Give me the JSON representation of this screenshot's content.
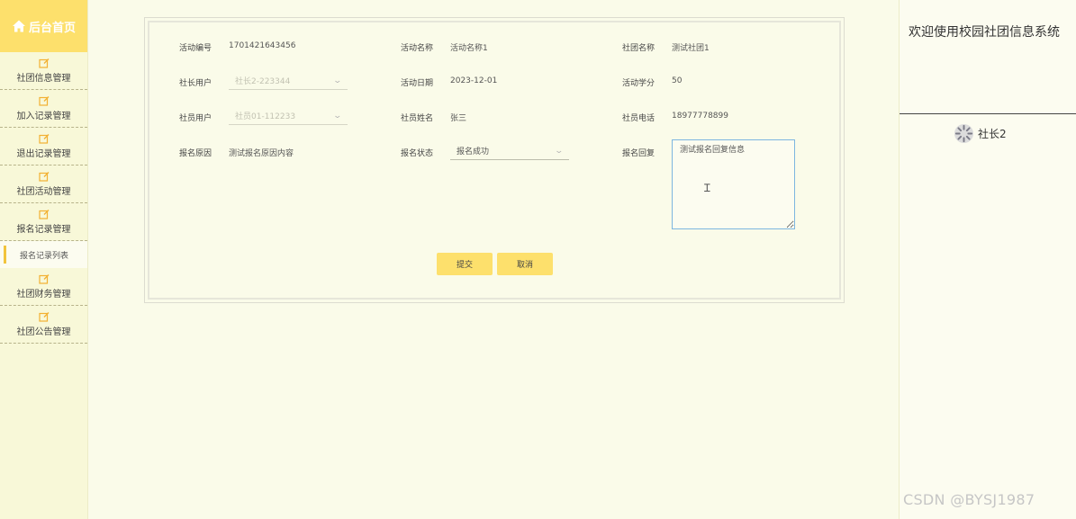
{
  "sidebar": {
    "brand": "后台首页",
    "items": [
      {
        "label": "社团信息管理"
      },
      {
        "label": "加入记录管理"
      },
      {
        "label": "退出记录管理"
      },
      {
        "label": "社团活动管理"
      },
      {
        "label": "报名记录管理"
      }
    ],
    "active_sub": "报名记录列表",
    "items_after": [
      {
        "label": "社团财务管理"
      },
      {
        "label": "社团公告管理"
      }
    ]
  },
  "header": {
    "welcome": "欢迎使用校园社团信息系统",
    "username": "社长2"
  },
  "form": {
    "activity_no_label": "活动编号",
    "activity_no_value": "1701421643456",
    "activity_name_label": "活动名称",
    "activity_name_value": "活动名称1",
    "club_name_label": "社团名称",
    "club_name_value": "测试社团1",
    "leader_user_label": "社长用户",
    "leader_user_value": "社长2-223344",
    "activity_date_label": "活动日期",
    "activity_date_value": "2023-12-01",
    "activity_credit_label": "活动学分",
    "activity_credit_value": "50",
    "member_user_label": "社员用户",
    "member_user_value": "社员01-112233",
    "member_name_label": "社员姓名",
    "member_name_value": "张三",
    "member_phone_label": "社员电话",
    "member_phone_value": "18977778899",
    "reason_label": "报名原因",
    "reason_value": "测试报名原因内容",
    "status_label": "报名状态",
    "status_value": "报名成功",
    "reply_label": "报名回复",
    "reply_value": "测试报名回复信息",
    "submit_label": "提交",
    "cancel_label": "取消"
  },
  "watermark": "CSDN @BYSJ1987",
  "colors": {
    "page_bg": "#fafbe9",
    "brand_bg": "#fde06c",
    "button_bg": "#fde06c",
    "active_bar": "#f2c43c",
    "textarea_border": "#7db6e0"
  }
}
